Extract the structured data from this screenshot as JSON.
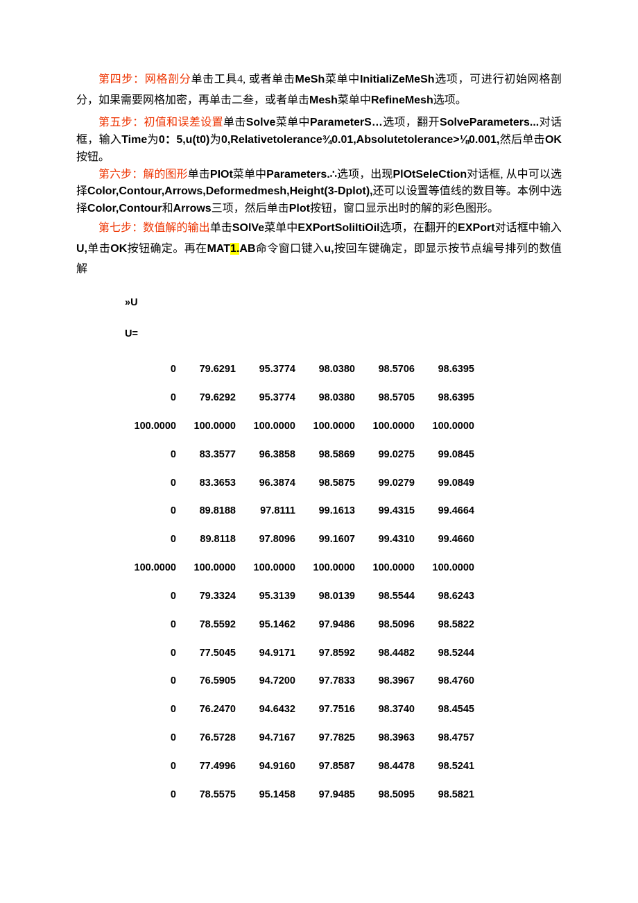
{
  "p1": {
    "step_label": "第四步：网格剖分",
    "t1": "单击工具4, 或者单击",
    "b1": "MeSh",
    "t2": "菜单中",
    "b2": "InitiaIiZeMeSh",
    "t3": "选项，可进行初始网格剖分，如果需要网格加密，再单击二叁，或者单击",
    "b3": "Mesh",
    "t4": "菜单中",
    "b4": "RefineMesh",
    "t5": "选项。"
  },
  "p2": {
    "step_label": "第五步：初值和误差设置",
    "t1": "单击",
    "b1": "Solve",
    "t2": "菜单中",
    "b2": "ParameterS…",
    "t3": "选项，翻开",
    "b3": "SolveParameters...",
    "t4": "对话框，输入",
    "b4": "Time",
    "t5": "为",
    "b5": "0：5,u(t0)",
    "t6": "为",
    "b6": "0,Relativetolerance¾0.01,Absolutetolerance>⅛0.001,",
    "t7": "然后单击",
    "b7": "OK",
    "t8": "按钮。"
  },
  "p3": {
    "step_label": "第六步：解的图形",
    "t1": "单击",
    "b1": "PIOt",
    "t2": "菜单中",
    "b2": "Parameters.∴",
    "t3": "选项，出现",
    "b3": "PlOtSeleCtion",
    "t4": "对话框, 从中可以选择",
    "b4": "Color,Contour,Arrows,Deformedmesh,Height(3-Dplot),",
    "t5": "还可以设置等值线的数目等。本例中选择",
    "b5": "Color,Contour",
    "t6": "和",
    "b6": "Arrows",
    "t7": "三项，然后单击",
    "b7": "Plot",
    "t8": "按钮，窗口显示出时的解的彩色图形。"
  },
  "p4": {
    "step_label": "第七步：数值解的输出",
    "t1": "单击",
    "b1": "SOlVe",
    "t2": "菜单中",
    "b2": "EXPortSoliItiOil",
    "t3": "选项，在翻开的",
    "b3": "EXPort",
    "t4": "对话框中输入",
    "b4": "U,",
    "t5": "单击",
    "b5": "OK",
    "t6": "按钮确定。再在",
    "b6a": "MAT",
    "hl": "1.",
    "b6b": "AB",
    "t7": "命令窗口键入",
    "b7": "u,",
    "t8": "按回车键确定，即显示按节点编号排列的数值解"
  },
  "code": {
    "prompt": "»U",
    "varline": "U="
  },
  "table": {
    "rows": [
      [
        "0",
        "79.6291",
        "95.3774",
        "98.0380",
        "98.5706",
        "98.6395"
      ],
      [
        "0",
        "79.6292",
        "95.3774",
        "98.0380",
        "98.5705",
        "98.6395"
      ],
      [
        "100.0000",
        "100.0000",
        "100.0000",
        "100.0000",
        "100.0000",
        "100.0000"
      ],
      [
        "0",
        "83.3577",
        "96.3858",
        "98.5869",
        "99.0275",
        "99.0845"
      ],
      [
        "0",
        "83.3653",
        "96.3874",
        "98.5875",
        "99.0279",
        "99.0849"
      ],
      [
        "0",
        "89.8188",
        "97.8111",
        "99.1613",
        "99.4315",
        "99.4664"
      ],
      [
        "0",
        "89.8118",
        "97.8096",
        "99.1607",
        "99.4310",
        "99.4660"
      ],
      [
        "100.0000",
        "100.0000",
        "100.0000",
        "100.0000",
        "100.0000",
        "100.0000"
      ],
      [
        "0",
        "79.3324",
        "95.3139",
        "98.0139",
        "98.5544",
        "98.6243"
      ],
      [
        "0",
        "78.5592",
        "95.1462",
        "97.9486",
        "98.5096",
        "98.5822"
      ],
      [
        "0",
        "77.5045",
        "94.9171",
        "97.8592",
        "98.4482",
        "98.5244"
      ],
      [
        "0",
        "76.5905",
        "94.7200",
        "97.7833",
        "98.3967",
        "98.4760"
      ],
      [
        "0",
        "76.2470",
        "94.6432",
        "97.7516",
        "98.3740",
        "98.4545"
      ],
      [
        "0",
        "76.5728",
        "94.7167",
        "97.7825",
        "98.3963",
        "98.4757"
      ],
      [
        "0",
        "77.4996",
        "94.9160",
        "97.8587",
        "98.4478",
        "98.5241"
      ],
      [
        "0",
        "78.5575",
        "95.1458",
        "97.9485",
        "98.5095",
        "98.5821"
      ]
    ]
  }
}
